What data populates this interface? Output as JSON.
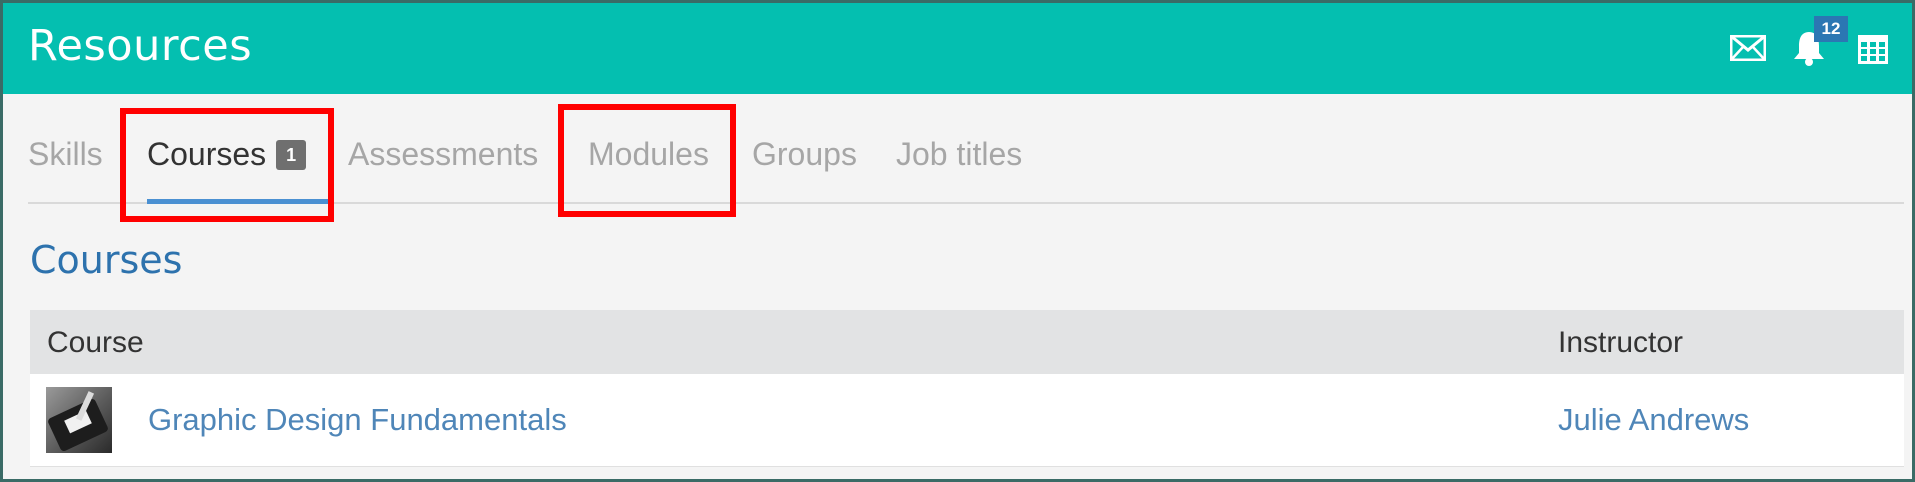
{
  "header": {
    "title": "Resources",
    "notification_count": "12",
    "icons": [
      "mail-icon",
      "bell-icon",
      "calendar-icon"
    ],
    "color": "#04bfb0"
  },
  "tabs": [
    {
      "label": "Skills",
      "active": false
    },
    {
      "label": "Courses",
      "active": true,
      "badge": "1"
    },
    {
      "label": "Assessments",
      "active": false
    },
    {
      "label": "Modules",
      "active": false
    },
    {
      "label": "Groups",
      "active": false
    },
    {
      "label": "Job titles",
      "active": false
    }
  ],
  "section": {
    "title": "Courses"
  },
  "table": {
    "columns": [
      "Course",
      "Instructor"
    ],
    "rows": [
      {
        "course": "Graphic Design Fundamentals",
        "instructor": "Julie Andrews",
        "thumbnail": "course-thumbnail"
      }
    ]
  },
  "colors": {
    "accent": "#04bfb0",
    "link": "#4f86b8",
    "tab_underline": "#4a90d2",
    "highlight": "#ff0000"
  }
}
